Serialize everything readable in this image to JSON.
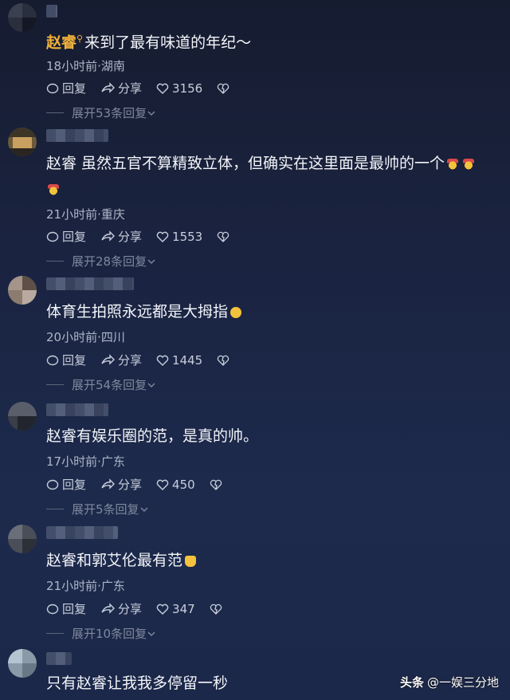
{
  "comments": [
    {
      "author": "赵睿",
      "text": "来到了最有味道的年纪～",
      "meta": "18小时前·湖南",
      "reply": "回复",
      "share": "分享",
      "likes": "3156",
      "expand": "展开53条回复"
    },
    {
      "text_line1": "赵睿 虽然五官不算精致立体，但确实在这里面是最帅的一个",
      "meta": "21小时前·重庆",
      "reply": "回复",
      "share": "分享",
      "likes": "1553",
      "expand": "展开28条回复"
    },
    {
      "text": "体育生拍照永远都是大拇指",
      "meta": "20小时前·四川",
      "reply": "回复",
      "share": "分享",
      "likes": "1445",
      "expand": "展开54条回复"
    },
    {
      "text": "赵睿有娱乐圈的范，是真的帅。",
      "meta": "17小时前·广东",
      "reply": "回复",
      "share": "分享",
      "likes": "450",
      "expand": "展开5条回复"
    },
    {
      "text": "赵睿和郭艾伦最有范",
      "meta": "21小时前·广东",
      "reply": "回复",
      "share": "分享",
      "likes": "347",
      "expand": "展开10条回复"
    },
    {
      "text": "只有赵睿让我我多停留一秒"
    }
  ],
  "watermark": {
    "brand": "头条",
    "handle": "@一娱三分地"
  },
  "icons": [
    "comment-icon",
    "share-icon",
    "heart-icon",
    "dislike-icon",
    "chevron-down-icon",
    "search-icon"
  ],
  "colors": {
    "author": "#f2b23c",
    "background": "#1a2340"
  }
}
